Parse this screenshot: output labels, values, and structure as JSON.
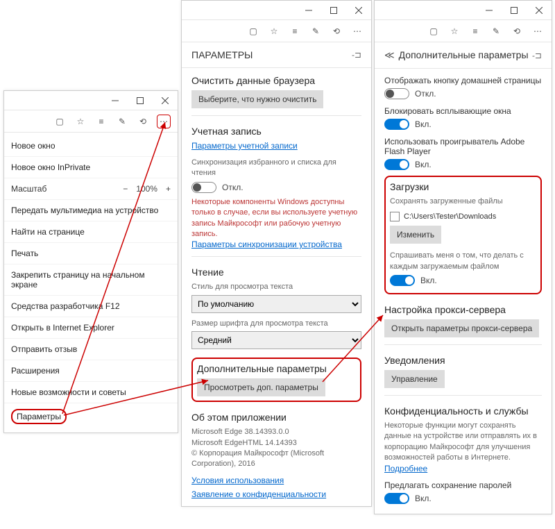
{
  "panel1": {
    "menu": [
      "Новое окно",
      "Новое окно InPrivate"
    ],
    "zoom": {
      "label": "Масштаб",
      "value": "100%"
    },
    "menu2": [
      "Передать мультимедиа на устройство",
      "Найти на странице",
      "Печать",
      "Закрепить страницу на начальном экране",
      "Средства разработчика F12",
      "Открыть в Internet Explorer",
      "Отправить отзыв",
      "Расширения",
      "Новые возможности и советы",
      "Параметры"
    ]
  },
  "panel2": {
    "title": "ПАРАМЕТРЫ",
    "clear_h": "Очистить данные браузера",
    "clear_btn": "Выберите, что нужно очистить",
    "acct_h": "Учетная запись",
    "acct_link": "Параметры учетной записи",
    "sync_label": "Синхронизация избранного и списка для чтения",
    "sync_state": "Откл.",
    "sync_warn": "Некоторые компоненты Windows доступны только в случае, если вы используете учетную запись Майкрософт или рабочую учетную запись.",
    "sync_link": "Параметры синхронизации устройства",
    "read_h": "Чтение",
    "style_label": "Стиль для просмотра текста",
    "style_val": "По умолчанию",
    "size_label": "Размер шрифта для просмотра текста",
    "size_val": "Средний",
    "adv_h": "Дополнительные параметры",
    "adv_btn": "Просмотреть доп. параметры",
    "about_h": "Об этом приложении",
    "about_1": "Microsoft Edge 38.14393.0.0",
    "about_2": "Microsoft EdgeHTML 14.14393",
    "about_3": "© Корпорация Майкрософт (Microsoft Corporation), 2016",
    "terms": "Условия использования",
    "privacy": "Заявление о конфиденциальности"
  },
  "panel3": {
    "title": "Дополнительные параметры",
    "home_label": "Отображать кнопку домашней страницы",
    "home_state": "Откл.",
    "popup_label": "Блокировать всплывающие окна",
    "on": "Вкл.",
    "flash_label": "Использовать проигрыватель Adobe Flash Player",
    "dl_h": "Загрузки",
    "dl_save": "Сохранять загруженные файлы",
    "dl_path": "C:\\Users\\Tester\\Downloads",
    "dl_change": "Изменить",
    "dl_ask": "Спрашивать меня о том, что делать с каждым загружаемым файлом",
    "proxy_h": "Настройка прокси-сервера",
    "proxy_btn": "Открыть параметры прокси-сервера",
    "notif_h": "Уведомления",
    "notif_btn": "Управление",
    "priv_h": "Конфиденциальность и службы",
    "priv_note": "Некоторые функции могут сохранять данные на устройстве или отправлять их в корпорацию Майкрософт для улучшения возможностей работы в Интернете.",
    "more": "Подробнее",
    "pass_label": "Предлагать сохранение паролей"
  }
}
